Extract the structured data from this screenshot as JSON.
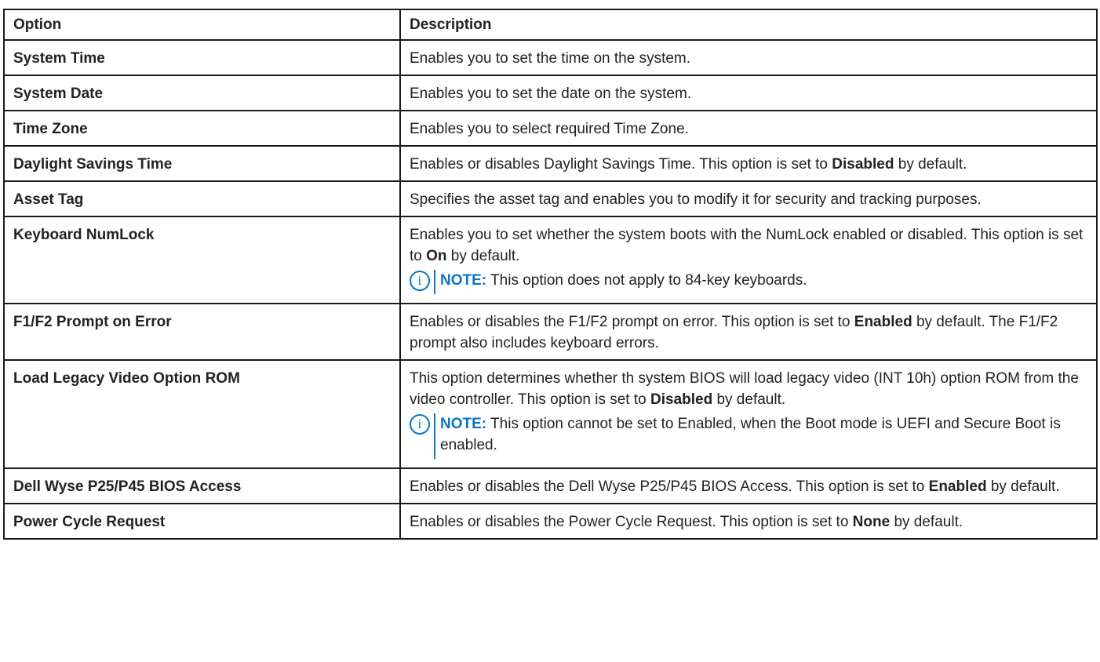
{
  "table": {
    "headers": {
      "option": "Option",
      "description": "Description"
    },
    "rows": [
      {
        "option": "System Time",
        "desc_pre": "Enables you to set the time on the system."
      },
      {
        "option": "System Date",
        "desc_pre": "Enables you to set the date on the system."
      },
      {
        "option": "Time Zone",
        "desc_pre": "Enables you to select required Time Zone."
      },
      {
        "option": "Daylight Savings Time",
        "desc_pre": "Enables or disables Daylight Savings Time. This option is set to ",
        "desc_bold": "Disabled",
        "desc_post": " by default."
      },
      {
        "option": "Asset Tag",
        "desc_pre": "Specifies the asset tag and enables you to modify it for security and tracking purposes."
      },
      {
        "option": "Keyboard NumLock",
        "desc_pre": "Enables you to set whether the system boots with the NumLock enabled or disabled. This option is set to ",
        "desc_bold": "On",
        "desc_post": " by default.",
        "note_label": "NOTE:",
        "note_text": " This option does not apply to 84-key keyboards."
      },
      {
        "option": "F1/F2 Prompt on Error",
        "desc_pre": "Enables or disables the F1/F2 prompt on error. This option is set to ",
        "desc_bold": "Enabled",
        "desc_post": " by default. The F1/F2 prompt also includes keyboard errors."
      },
      {
        "option": "Load Legacy Video Option ROM",
        "desc_pre": "This option determines whether th system BIOS will load legacy video (INT 10h) option ROM from the video controller. This option is set to ",
        "desc_bold": "Disabled",
        "desc_post": " by default.",
        "note_label": "NOTE:",
        "note_text": " This option cannot be set to Enabled, when the Boot mode is UEFI and Secure Boot is enabled."
      },
      {
        "option": "Dell Wyse P25/P45 BIOS Access",
        "desc_pre": "Enables or disables the Dell Wyse P25/P45 BIOS Access. This option is set to ",
        "desc_bold": "Enabled",
        "desc_post": " by default."
      },
      {
        "option": "Power Cycle Request",
        "desc_pre": "Enables or disables the Power Cycle Request. This option is set to ",
        "desc_bold": "None",
        "desc_post": " by default."
      }
    ]
  },
  "icons": {
    "note": "info-circle-icon",
    "note_glyph": "i"
  },
  "colors": {
    "note_accent": "#0a76c0",
    "border": "#1a1a1a",
    "text": "#222222"
  }
}
